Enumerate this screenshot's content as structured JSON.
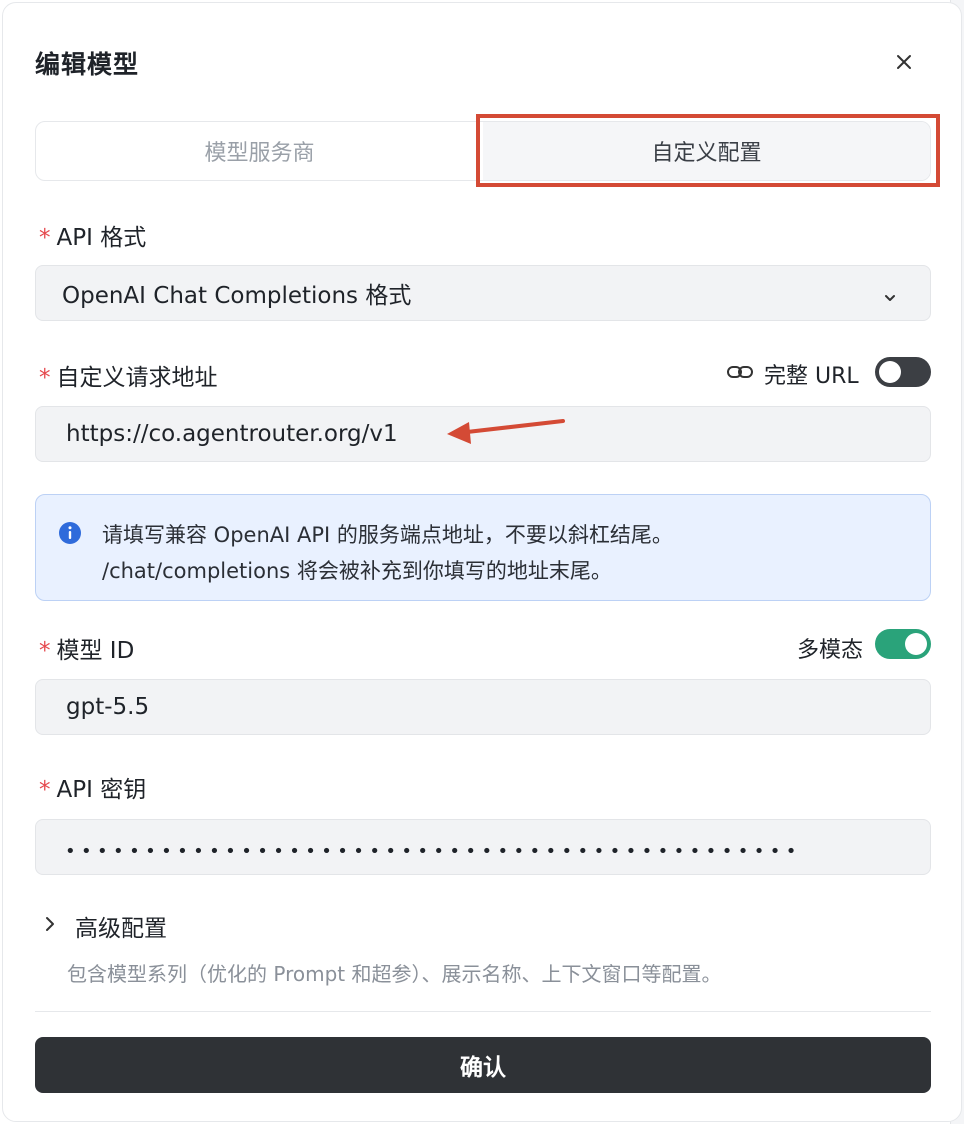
{
  "dialog": {
    "title": "编辑模型"
  },
  "tabs": [
    {
      "label": "模型服务商",
      "active": false
    },
    {
      "label": "自定义配置",
      "active": true
    }
  ],
  "api_format": {
    "required_mark": "*",
    "label": "API 格式",
    "selected": "OpenAI Chat Completions 格式"
  },
  "endpoint": {
    "required_mark": "*",
    "label": "自定义请求地址",
    "full_url_label": "完整 URL",
    "full_url_enabled": false,
    "value": "https://co.agentrouter.org/v1"
  },
  "info_box": {
    "line1": "请填写兼容 OpenAI API 的服务端点地址，不要以斜杠结尾。",
    "line2": "/chat/completions 将会被补充到你填写的地址末尾。"
  },
  "model_id": {
    "required_mark": "*",
    "label": "模型 ID",
    "multimodal_label": "多模态",
    "multimodal_enabled": true,
    "value": "gpt-5.5"
  },
  "api_key": {
    "required_mark": "*",
    "label": "API 密钥",
    "masked_value": "••••••••••••••••••••••••••••••••••••••••••••••"
  },
  "advanced": {
    "title": "高级配置",
    "description": "包含模型系列（优化的 Prompt 和超参）、展示名称、上下文窗口等配置。",
    "expanded": false
  },
  "confirm_label": "确认",
  "colors": {
    "accent_red": "#d44a35",
    "toggle_on": "#2aa37a",
    "info_bg": "#e9f1ff",
    "info_icon": "#2f6bdb",
    "primary_button": "#2f3236"
  },
  "icons": [
    "close-icon",
    "chevron-down-icon",
    "link-icon",
    "info-icon",
    "chevron-right-icon",
    "arrow-annotation"
  ]
}
